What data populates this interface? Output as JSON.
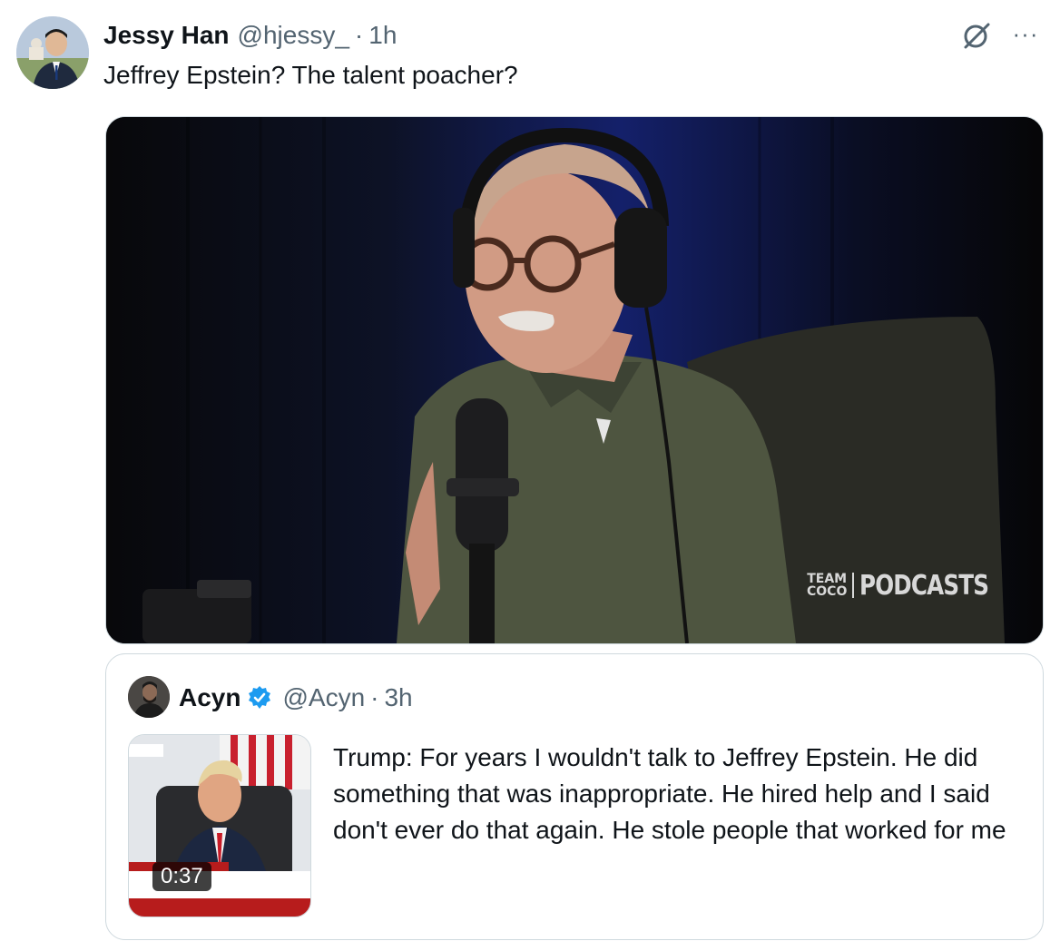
{
  "tweet": {
    "author_name": "Jessy Han",
    "author_handle": "@hjessy_",
    "separator": "·",
    "time": "1h",
    "text": "Jeffrey Epstein? The talent poacher?",
    "more_label": "···",
    "grok_icon": "grok-icon",
    "avatar_icon": "avatar"
  },
  "media": {
    "watermark_team": "TEAM",
    "watermark_coco": "COCO",
    "watermark_podcasts": "PODCASTS"
  },
  "quote": {
    "author_name": "Acyn",
    "author_handle": "@Acyn",
    "separator": "·",
    "time": "3h",
    "verified_icon": "verified-badge-icon",
    "text": "Trump: For years I wouldn't talk to Jeffrey Epstein. He did something that was inappropriate. He hired help and I said don't ever do that again. He stole people that worked for me",
    "video_duration": "0:37"
  },
  "colors": {
    "text_primary": "#0f1419",
    "text_secondary": "#536471",
    "border": "#cfd9de",
    "verified": "#1d9bf0"
  }
}
